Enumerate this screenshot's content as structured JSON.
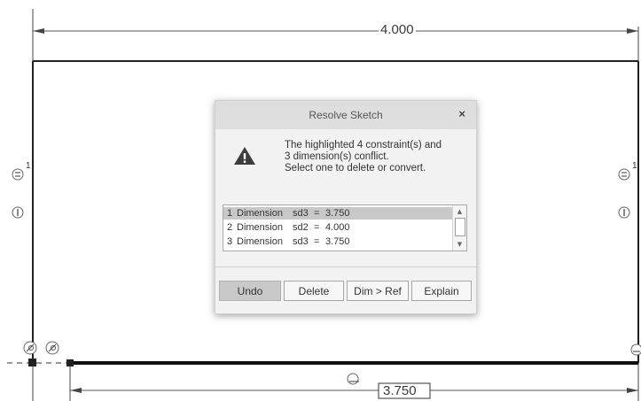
{
  "sketch": {
    "top_dimension": "4.000",
    "bottom_dimension": "3.750",
    "constraint_count_left": "1",
    "constraint_count_right": "1",
    "icons": [
      "equal-constraint-icon",
      "vertical-constraint-icon",
      "fix-constraint-icon",
      "tangent-constraint-icon"
    ]
  },
  "dialog": {
    "title": "Resolve Sketch",
    "close_label": "×",
    "message_lines": [
      "The highlighted 4 constraint(s) and",
      "3 dimension(s) conflict.",
      "Select one to delete or convert."
    ],
    "items": [
      {
        "num": "1",
        "type": "Dimension",
        "name": "sd3",
        "eq": "=",
        "value": "3.750",
        "selected": true
      },
      {
        "num": "2",
        "type": "Dimension",
        "name": "sd2",
        "eq": "=",
        "value": "4.000",
        "selected": false
      },
      {
        "num": "3",
        "type": "Dimension",
        "name": "sd3",
        "eq": "=",
        "value": "3.750",
        "selected": false
      }
    ],
    "buttons": {
      "undo": "Undo",
      "delete": "Delete",
      "dim_to_ref": "Dim > Ref",
      "explain": "Explain"
    }
  }
}
